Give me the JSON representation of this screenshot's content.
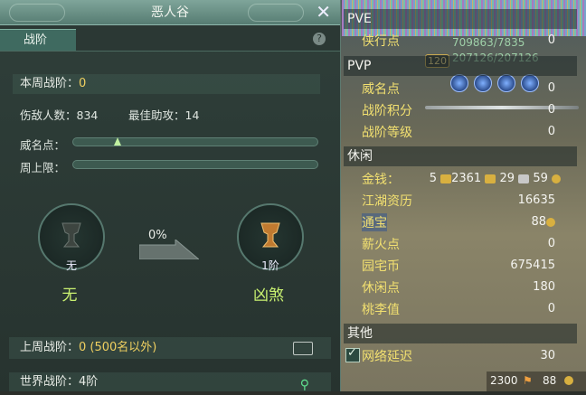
{
  "window": {
    "title": "恶人谷"
  },
  "tabs": [
    {
      "label": "战阶"
    }
  ],
  "weekly": {
    "label": "本周战阶：",
    "value": "0"
  },
  "stats_line": {
    "kills_label": "伤敌人数：",
    "kills": "834",
    "assist_label": "最佳助攻：",
    "assist": "14"
  },
  "prestige": {
    "label": "威名点：",
    "progress": 0.17
  },
  "weekcap": {
    "label": "周上限：",
    "progress": 0
  },
  "current_rank": {
    "tier": "无",
    "name": "无"
  },
  "next_rank": {
    "tier": "1阶",
    "name": "凶煞"
  },
  "progress_pct": "0%",
  "last_week": {
    "label": "上周战阶：",
    "value": "0 (500名以外)"
  },
  "world": {
    "label": "世界战阶：",
    "value": "4阶"
  },
  "scene": {
    "hp_text": "709863/7835",
    "mp_text": "207126/207126",
    "level": "120",
    "bar_value": "0"
  },
  "panel": {
    "pve": {
      "title": "PVE",
      "items": [
        {
          "label": "侠行点",
          "value": "0"
        }
      ]
    },
    "pvp": {
      "title": "PVP",
      "items": [
        {
          "label": "威名点",
          "value": "0"
        },
        {
          "label": "战阶积分",
          "value": "0"
        },
        {
          "label": "战阶等级",
          "value": "0"
        }
      ]
    },
    "leisure": {
      "title": "休闲",
      "items": [
        {
          "label": "金钱：",
          "value": "5 2361 29 59"
        },
        {
          "label": "江湖资历",
          "value": "16635"
        },
        {
          "label": "通宝",
          "value": "88"
        },
        {
          "label": "薪火点",
          "value": "0"
        },
        {
          "label": "园宅币",
          "value": "675415"
        },
        {
          "label": "休闲点",
          "value": "180"
        },
        {
          "label": "桃李值",
          "value": "0"
        }
      ]
    },
    "other": {
      "title": "其他",
      "items": [
        {
          "label": "网络延迟",
          "value": "30"
        }
      ]
    }
  },
  "money": {
    "gold": "5",
    "bricks": "2361",
    "silver": "29",
    "copper": "59"
  },
  "bottom": {
    "left_value": "2300",
    "right_value": "88"
  },
  "icons": {
    "close": "close-icon",
    "help": "help-icon",
    "mail": "mail-icon",
    "pin": "location-pin-icon"
  }
}
